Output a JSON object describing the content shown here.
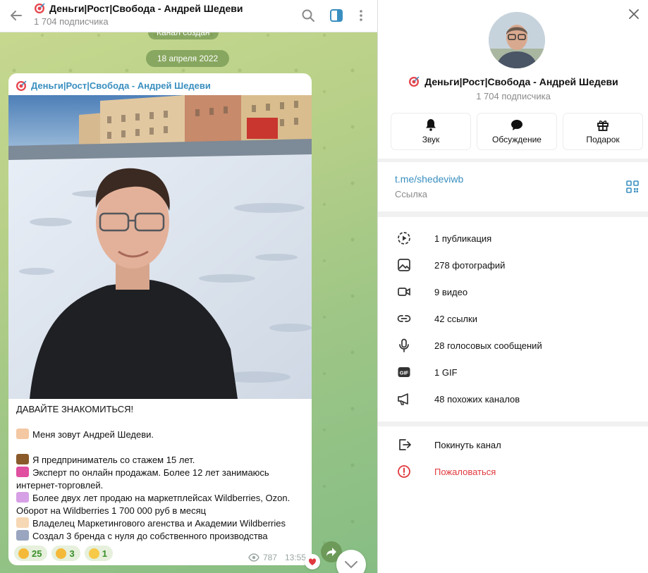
{
  "chat": {
    "header": {
      "title": "Деньги|Рост|Свобода - Андрей Шедеви",
      "subscribers": "1 704 подписчика",
      "icons": [
        "back-arrow-icon",
        "search-icon",
        "sidebar-toggle-icon",
        "more-vertical-icon"
      ]
    },
    "service_message": "Канал создан",
    "date_label": "18 апреля 2022",
    "post": {
      "author": "Деньги|Рост|Свобода - Андрей Шедеви",
      "heading": "ДАВАЙТЕ ЗНАКОМИТЬСЯ!",
      "lines": [
        {
          "emoji": "waving-hand",
          "text": "Меня зовут Андрей Шедеви."
        },
        {
          "emoji": "briefcase",
          "text": "Я предприниматель со стажем 15 лет."
        },
        {
          "emoji": "shopping-bags",
          "text": "Эксперт по онлайн продажам. Более 12 лет занимаюсь интернет-торговлей."
        },
        {
          "emoji": "shopping-bag",
          "text": "Более двух лет продаю на маркетплейсах Wildberries, Ozon. Оборот на Wildberries 1 700 000 руб в месяц"
        },
        {
          "emoji": "raising-hands",
          "text": "Владелец Маркетингового агенства и Академии Wildberries"
        },
        {
          "emoji": "rocket",
          "text": "Создал 3 бренда с нуля до собственного производства"
        }
      ],
      "lines_wrapped": [
        "Эксперт по онлайн продажам. Более 12 лет занимаюсь",
        "интернет-торговлей.",
        "Более двух лет продаю на маркетплейсах Wildberries, Ozon.",
        "Оборот на Wildberries 1 700 000 руб в месяц"
      ],
      "reactions": [
        {
          "emoji": "thumbs-up",
          "count": "25"
        },
        {
          "emoji": "clapping-hands",
          "count": "3"
        },
        {
          "emoji": "grinning-face",
          "count": "1"
        }
      ],
      "views": "787",
      "time": "13:55"
    }
  },
  "panel": {
    "title": "Деньги|Рост|Свобода - Андрей Шедеви",
    "subscribers": "1 704 подписчика",
    "actions": [
      {
        "label": "Звук",
        "icon": "bell-icon"
      },
      {
        "label": "Обсуждение",
        "icon": "chat-bubble-icon"
      },
      {
        "label": "Подарок",
        "icon": "gift-icon"
      }
    ],
    "link": {
      "value": "t.me/shedeviwb",
      "label": "Ссылка"
    },
    "media": [
      {
        "label": "1 публикация",
        "icon": "stories-icon"
      },
      {
        "label": "278 фотографий",
        "icon": "photo-icon"
      },
      {
        "label": "9 видео",
        "icon": "video-icon"
      },
      {
        "label": "42 ссылки",
        "icon": "link-icon"
      },
      {
        "label": "28 голосовых сообщений",
        "icon": "microphone-icon"
      },
      {
        "label": "1 GIF",
        "icon": "gif-icon"
      },
      {
        "label": "48 похожих каналов",
        "icon": "megaphone-icon"
      }
    ],
    "leave": "Покинуть канал",
    "report": "Пожаловаться",
    "colors": {
      "accent": "#3a8fc0",
      "danger": "#e0393e",
      "reaction": "#3a8f2a"
    }
  }
}
